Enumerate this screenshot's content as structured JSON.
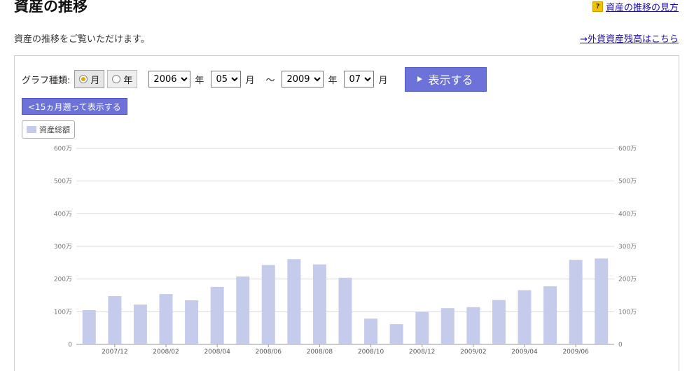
{
  "page": {
    "title": "資産の推移",
    "help_link": "資産の推移の見方",
    "help_icon": "question-icon",
    "description": "資産の推移をご覧いただけます。",
    "fx_link": "→外貨資産残高はこちら"
  },
  "controls": {
    "graph_type_label": "グラフ種類:",
    "radio_month": "月",
    "radio_year": "年",
    "selected": "月",
    "from_year": "2006",
    "from_month": "05",
    "to_year": "2009",
    "to_month": "07",
    "year_unit": "年",
    "month_unit": "月",
    "tilde": "～",
    "show_button": "表示する",
    "back_button": "<15ヵ月遡って表示する"
  },
  "colors": {
    "bar": "#c5cceb",
    "button": "#6c72d8",
    "grid": "#d8d8d8"
  },
  "chart_data": {
    "type": "bar",
    "legend": [
      "資産総額"
    ],
    "y_ticks": [
      "0",
      "100万",
      "200万",
      "300万",
      "400万",
      "500万",
      "600万"
    ],
    "ylim": [
      0,
      6000000
    ],
    "grid": true,
    "categories": [
      "2007/11",
      "2007/12",
      "2008/01",
      "2008/02",
      "2008/03",
      "2008/04",
      "2008/05",
      "2008/06",
      "2008/07",
      "2008/08",
      "2008/09",
      "2008/10",
      "2008/11",
      "2008/12",
      "2009/01",
      "2009/02",
      "2009/03",
      "2009/04",
      "2009/05",
      "2009/06",
      "2009/07"
    ],
    "x_tick_labels": [
      "2007/12",
      "2008/02",
      "2008/04",
      "2008/06",
      "2008/08",
      "2008/10",
      "2008/12",
      "2009/02",
      "2009/04",
      "2009/06"
    ],
    "series": [
      {
        "name": "資産総額",
        "values": [
          1050000,
          1480000,
          1220000,
          1540000,
          1350000,
          1760000,
          2080000,
          2430000,
          2610000,
          2450000,
          2040000,
          790000,
          620000,
          990000,
          1110000,
          1140000,
          1360000,
          1660000,
          1780000,
          2590000,
          2630000
        ]
      }
    ]
  }
}
